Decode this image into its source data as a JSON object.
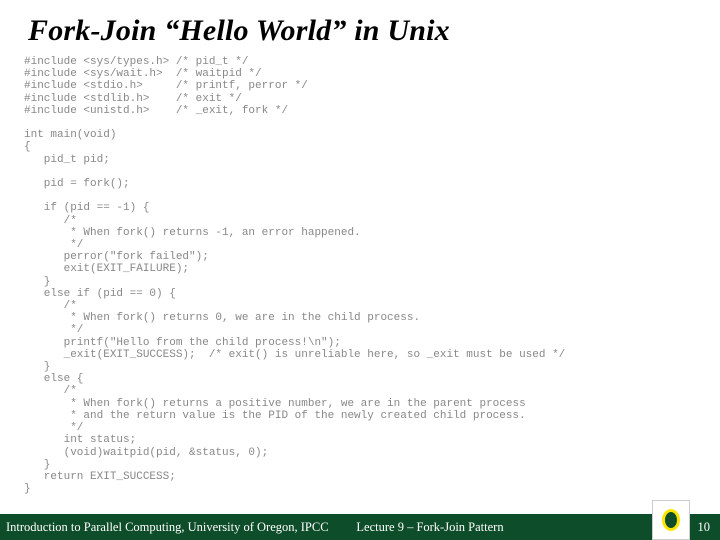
{
  "title": "Fork-Join “Hello World” in Unix",
  "code": "#include <sys/types.h> /* pid_t */\n#include <sys/wait.h>  /* waitpid */\n#include <stdio.h>     /* printf, perror */\n#include <stdlib.h>    /* exit */\n#include <unistd.h>    /* _exit, fork */\n\nint main(void)\n{\n   pid_t pid;\n\n   pid = fork();\n\n   if (pid == -1) {\n      /*\n       * When fork() returns -1, an error happened.\n       */\n      perror(\"fork failed\");\n      exit(EXIT_FAILURE);\n   }\n   else if (pid == 0) {\n      /*\n       * When fork() returns 0, we are in the child process.\n       */\n      printf(\"Hello from the child process!\\n\");\n      _exit(EXIT_SUCCESS);  /* exit() is unreliable here, so _exit must be used */\n   }\n   else {\n      /*\n       * When fork() returns a positive number, we are in the parent process\n       * and the return value is the PID of the newly created child process.\n       */\n      int status;\n      (void)waitpid(pid, &status, 0);\n   }\n   return EXIT_SUCCESS;\n}",
  "footer": {
    "left": "Introduction to Parallel Computing, University of Oregon, IPCC",
    "center": "Lecture 9 – Fork-Join Pattern",
    "page": "10"
  }
}
